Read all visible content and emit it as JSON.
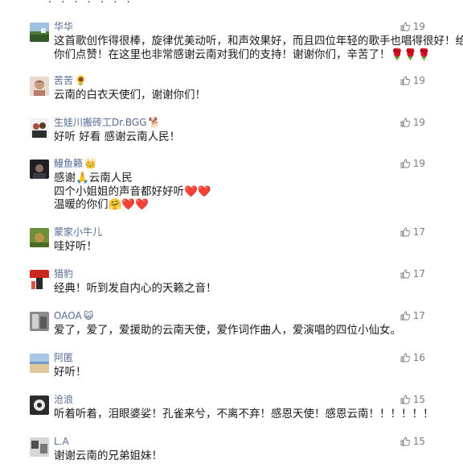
{
  "comments": [
    {
      "nickname": "华华",
      "nick_suffix": "",
      "lines": [
        "这首歌创作得很棒，旋律优美动听，和声效果好，而且四位年轻的歌手也唱得很好！给",
        "你们点赞！在这里也非常感谢云南对我们的支持！谢谢你们，辛苦了！🌹🌹🌹"
      ],
      "likes": "19",
      "avatar": "landscape-avatar"
    },
    {
      "nickname": "苦苦",
      "nick_suffix": "🌻",
      "lines": [
        "云南的白衣天使们，谢谢你们！"
      ],
      "likes": "19",
      "avatar": "girl-avatar"
    },
    {
      "nickname": "生娃川搬砖工Dr.BGG",
      "nick_suffix": "🐕",
      "lines": [
        "好听 好看 感谢云南人民！"
      ],
      "likes": "19",
      "avatar": "people-avatar"
    },
    {
      "nickname": "鳗鱼籁",
      "nick_suffix": "👑",
      "lines": [
        "感谢🙏云南人民",
        "四个小姐姐的声音都好好听❤️❤️",
        "温暖的你们🤗❤️❤️"
      ],
      "likes": "19",
      "avatar": "dark-avatar"
    },
    {
      "nickname": "蒙家小牛儿",
      "nick_suffix": "",
      "lines": [
        "哇好听！"
      ],
      "likes": "17",
      "avatar": "green-avatar"
    },
    {
      "nickname": "猎豹",
      "nick_suffix": "",
      "lines": [
        "经典！听到发自内心的天籁之音！"
      ],
      "likes": "17",
      "avatar": "red-avatar"
    },
    {
      "nickname": "OAOA",
      "nick_suffix": "😺",
      "lines": [
        "爱了，爱了，爱援助的云南天使，爱作词作曲人，爱演唱的四位小仙女。"
      ],
      "likes": "17",
      "avatar": "gray-avatar"
    },
    {
      "nickname": "阿匿",
      "nick_suffix": "",
      "lines": [
        "好听！"
      ],
      "likes": "16",
      "avatar": "beach-avatar"
    },
    {
      "nickname": "沧浪",
      "nick_suffix": "",
      "lines": [
        "听着听着，泪眼婆娑！孔雀来兮，不离不弃！感恩天使！感恩云南！！！！！！"
      ],
      "likes": "15",
      "avatar": "bw-avatar"
    },
    {
      "nickname": "L.A",
      "nick_suffix": "",
      "lines": [
        "谢谢云南的兄弟姐妹！"
      ],
      "likes": "15",
      "avatar": "photo-avatar"
    }
  ],
  "colors": {
    "nickname": "#576b95",
    "text": "#1a1a1a",
    "like": "#7d7d7d"
  },
  "icons": {
    "like": "thumb-up-icon"
  }
}
